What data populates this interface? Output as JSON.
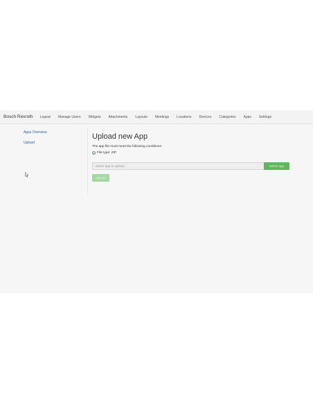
{
  "navbar": {
    "brand": "Bosch Rexroth",
    "items": [
      "Logout",
      "Manage Users",
      "Widgets",
      "Attachments",
      "Layouts",
      "Meetings",
      "Locations",
      "Devices",
      "Categories",
      "Apps",
      "Settings"
    ]
  },
  "sidebar": {
    "items": [
      "Apps Overview",
      "Upload"
    ]
  },
  "main": {
    "title": "Upload new App",
    "conditions_intro": "The app file must meet the following conditions:",
    "file_type_condition": "File type: ZIP",
    "file_input_placeholder": "Select app to upload...",
    "select_button": "Select app",
    "upload_button": "Upload"
  },
  "colors": {
    "accent_green": "#5cb85c",
    "disabled_green": "#a3d9a3",
    "link_blue": "#2a6496"
  },
  "icons": {
    "condition_icon": "check-circle-icon",
    "cursor": "mouse-pointer-icon"
  }
}
